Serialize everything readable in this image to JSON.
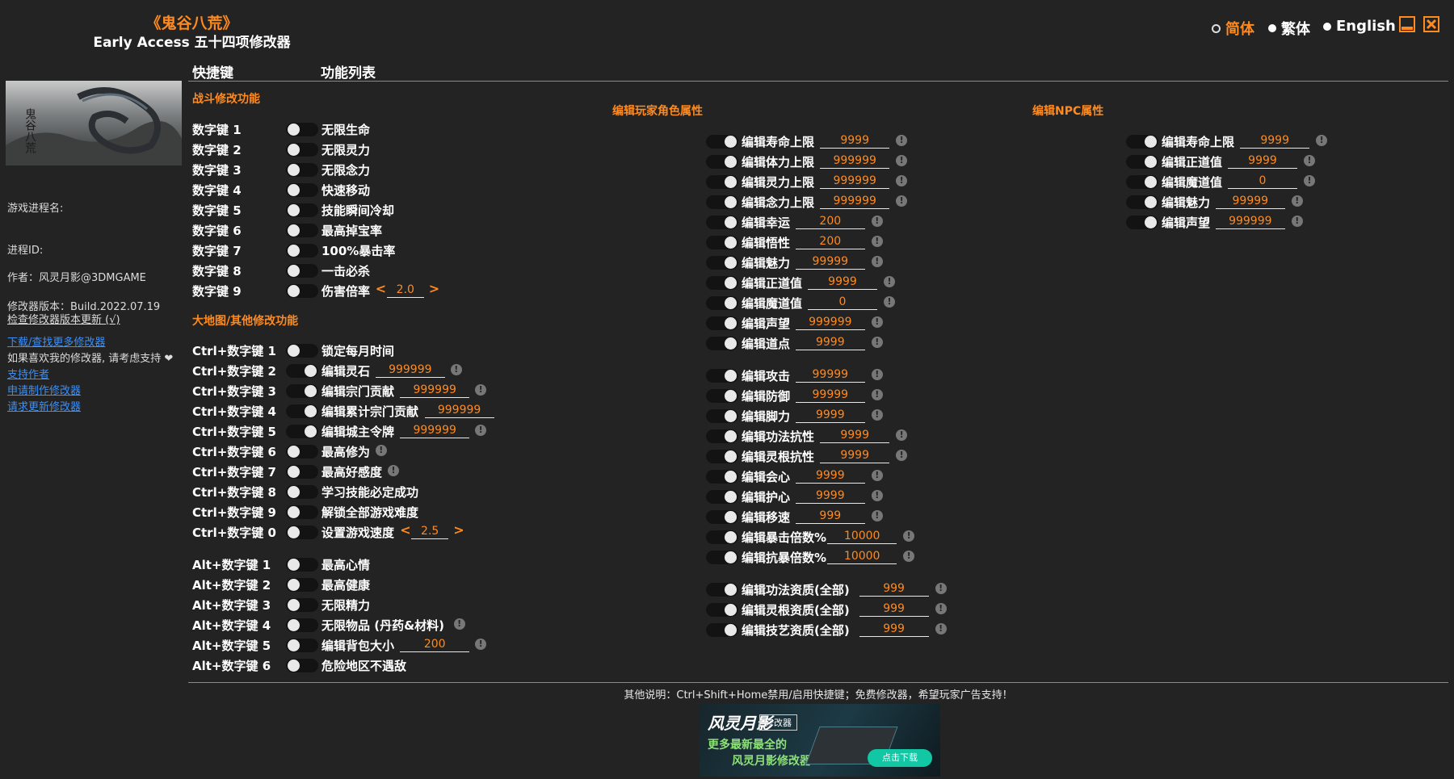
{
  "app": {
    "game_title": "《鬼谷八荒》",
    "subtitle": "Early Access 五十四项修改器",
    "languages": [
      {
        "label": "简体",
        "selected": true,
        "color": "#ff8a1f"
      },
      {
        "label": "繁体",
        "selected": false,
        "color": "#ffffff"
      },
      {
        "label": "English",
        "selected": false,
        "color": "#ffffff"
      }
    ],
    "accent_color": "#ff8a1f"
  },
  "headers": {
    "hotkey": "快捷键",
    "features": "功能列表"
  },
  "sidebar": {
    "process_name_label": "游戏进程名:",
    "process_id_label": "进程ID:",
    "author": "作者：风灵月影@3DMGAME",
    "version": "修改器版本：Build.2022.07.19",
    "check_update": "检查修改器版本更新 (√)",
    "download_link": "下载/查找更多修改器",
    "support_text": "如果喜欢我的修改器, 请考虑支持",
    "support_author": "支持作者",
    "request_make": "申请制作修改器",
    "request_update": "请求更新修改器"
  },
  "battle": {
    "title": "战斗修改功能",
    "items": [
      {
        "hotkey": "数字键 1",
        "label": "无限生命"
      },
      {
        "hotkey": "数字键 2",
        "label": "无限灵力"
      },
      {
        "hotkey": "数字键 3",
        "label": "无限念力"
      },
      {
        "hotkey": "数字键 4",
        "label": "快速移动"
      },
      {
        "hotkey": "数字键 5",
        "label": "技能瞬间冷却"
      },
      {
        "hotkey": "数字键 6",
        "label": "最高掉宝率"
      },
      {
        "hotkey": "数字键 7",
        "label": "100%暴击率"
      },
      {
        "hotkey": "数字键 8",
        "label": "一击必杀"
      },
      {
        "hotkey": "数字键 9",
        "label": "伤害倍率",
        "value": "2.0",
        "arrows": true
      }
    ]
  },
  "map": {
    "title": "大地图/其他修改功能",
    "ctrl_items": [
      {
        "hotkey": "Ctrl+数字键 1",
        "label": "锁定每月时间"
      },
      {
        "hotkey": "Ctrl+数字键 2",
        "label": "编辑灵石",
        "value": "999999",
        "info": true,
        "knob_right": true
      },
      {
        "hotkey": "Ctrl+数字键 3",
        "label": "编辑宗门贡献",
        "value": "999999",
        "info": true,
        "knob_right": true
      },
      {
        "hotkey": "Ctrl+数字键 4",
        "label": "编辑累计宗门贡献",
        "value": "999999",
        "info": false,
        "knob_right": true
      },
      {
        "hotkey": "Ctrl+数字键 5",
        "label": "编辑城主令牌",
        "value": "999999",
        "info": true,
        "knob_right": true
      },
      {
        "hotkey": "Ctrl+数字键 6",
        "label": "最高修为",
        "info": true
      },
      {
        "hotkey": "Ctrl+数字键 7",
        "label": "最高好感度",
        "info": true
      },
      {
        "hotkey": "Ctrl+数字键 8",
        "label": "学习技能必定成功"
      },
      {
        "hotkey": "Ctrl+数字键 9",
        "label": "解锁全部游戏难度"
      },
      {
        "hotkey": "Ctrl+数字键 0",
        "label": "设置游戏速度",
        "value": "2.5",
        "arrows": true
      }
    ],
    "alt_items": [
      {
        "hotkey": "Alt+数字键 1",
        "label": "最高心情"
      },
      {
        "hotkey": "Alt+数字键 2",
        "label": "最高健康"
      },
      {
        "hotkey": "Alt+数字键 3",
        "label": "无限精力"
      },
      {
        "hotkey": "Alt+数字键 4",
        "label": "无限物品 (丹药&材料)",
        "info": true
      },
      {
        "hotkey": "Alt+数字键 5",
        "label": "编辑背包大小",
        "value": "200",
        "info": true
      },
      {
        "hotkey": "Alt+数字键 6",
        "label": "危险地区不遇敌"
      }
    ]
  },
  "player": {
    "title": "编辑玩家角色属性",
    "group1": [
      {
        "label": "编辑寿命上限",
        "value": "9999"
      },
      {
        "label": "编辑体力上限",
        "value": "999999"
      },
      {
        "label": "编辑灵力上限",
        "value": "999999"
      },
      {
        "label": "编辑念力上限",
        "value": "999999"
      },
      {
        "label": "编辑幸运",
        "value": "200"
      },
      {
        "label": "编辑悟性",
        "value": "200"
      },
      {
        "label": "编辑魅力",
        "value": "99999"
      },
      {
        "label": "编辑正道值",
        "value": "9999"
      },
      {
        "label": "编辑魔道值",
        "value": "0"
      },
      {
        "label": "编辑声望",
        "value": "999999"
      },
      {
        "label": "编辑道点",
        "value": "9999"
      }
    ],
    "group2": [
      {
        "label": "编辑攻击",
        "value": "99999"
      },
      {
        "label": "编辑防御",
        "value": "99999"
      },
      {
        "label": "编辑脚力",
        "value": "9999"
      },
      {
        "label": "编辑功法抗性",
        "value": "9999"
      },
      {
        "label": "编辑灵根抗性",
        "value": "9999"
      },
      {
        "label": "编辑会心",
        "value": "9999"
      },
      {
        "label": "编辑护心",
        "value": "9999"
      },
      {
        "label": "编辑移速",
        "value": "999"
      },
      {
        "label": "编辑暴击倍数%",
        "value": "10000"
      },
      {
        "label": "编辑抗暴倍数%",
        "value": "10000"
      }
    ],
    "group3": [
      {
        "label": "编辑功法资质(全部)",
        "value": "999"
      },
      {
        "label": "编辑灵根资质(全部)",
        "value": "999"
      },
      {
        "label": "编辑技艺资质(全部)",
        "value": "999"
      }
    ]
  },
  "npc": {
    "title": "编辑NPC属性",
    "items": [
      {
        "label": "编辑寿命上限",
        "value": "9999"
      },
      {
        "label": "编辑正道值",
        "value": "9999"
      },
      {
        "label": "编辑魔道值",
        "value": "0"
      },
      {
        "label": "编辑魅力",
        "value": "99999"
      },
      {
        "label": "编辑声望",
        "value": "999999"
      }
    ]
  },
  "footer": {
    "note": "其他说明：Ctrl+Shift+Home禁用/启用快捷键；免费修改器，希望玩家广告支持！"
  },
  "banner": {
    "logo": "风灵月影",
    "tag": "修改器",
    "line1": "更多最新最全的",
    "line2": "风灵月影修改器",
    "button": "点击下载"
  },
  "cover_image": {
    "text": "鬼谷八荒"
  }
}
